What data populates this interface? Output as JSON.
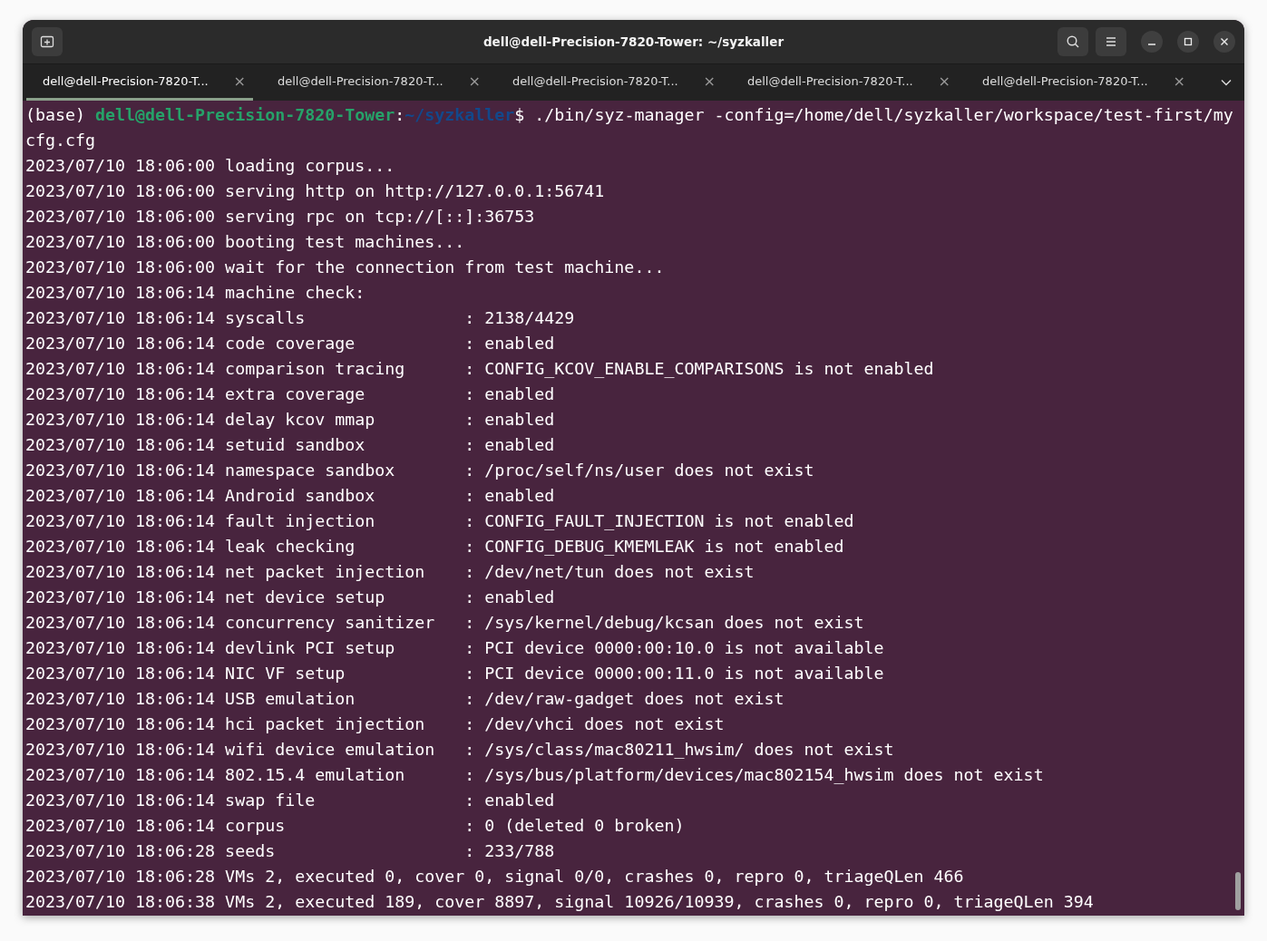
{
  "window": {
    "title": "dell@dell-Precision-7820-Tower: ~/syzkaller"
  },
  "tabs": [
    {
      "label": "dell@dell-Precision-7820-T...",
      "close": "×",
      "selected": true
    },
    {
      "label": "dell@dell-Precision-7820-T...",
      "close": "×",
      "selected": false
    },
    {
      "label": "dell@dell-Precision-7820-T...",
      "close": "×",
      "selected": false
    },
    {
      "label": "dell@dell-Precision-7820-T...",
      "close": "×",
      "selected": false
    },
    {
      "label": "dell@dell-Precision-7820-T...",
      "close": "×",
      "selected": false
    }
  ],
  "prompt": {
    "env": "(base) ",
    "user_host": "dell@dell-Precision-7820-Tower",
    "separator": ":",
    "path": "~/syzkaller",
    "symbol": "$ ",
    "command": "./bin/syz-manager -config=/home/dell/syzkaller/workspace/test-first/mycfg.cfg"
  },
  "lines": [
    "2023/07/10 18:06:00 loading corpus...",
    "2023/07/10 18:06:00 serving http on http://127.0.0.1:56741",
    "2023/07/10 18:06:00 serving rpc on tcp://[::]:36753",
    "2023/07/10 18:06:00 booting test machines...",
    "2023/07/10 18:06:00 wait for the connection from test machine...",
    "2023/07/10 18:06:14 machine check:",
    "2023/07/10 18:06:14 syscalls                : 2138/4429",
    "2023/07/10 18:06:14 code coverage           : enabled",
    "2023/07/10 18:06:14 comparison tracing      : CONFIG_KCOV_ENABLE_COMPARISONS is not enabled",
    "2023/07/10 18:06:14 extra coverage          : enabled",
    "2023/07/10 18:06:14 delay kcov mmap         : enabled",
    "2023/07/10 18:06:14 setuid sandbox          : enabled",
    "2023/07/10 18:06:14 namespace sandbox       : /proc/self/ns/user does not exist",
    "2023/07/10 18:06:14 Android sandbox         : enabled",
    "2023/07/10 18:06:14 fault injection         : CONFIG_FAULT_INJECTION is not enabled",
    "2023/07/10 18:06:14 leak checking           : CONFIG_DEBUG_KMEMLEAK is not enabled",
    "2023/07/10 18:06:14 net packet injection    : /dev/net/tun does not exist",
    "2023/07/10 18:06:14 net device setup        : enabled",
    "2023/07/10 18:06:14 concurrency sanitizer   : /sys/kernel/debug/kcsan does not exist",
    "2023/07/10 18:06:14 devlink PCI setup       : PCI device 0000:00:10.0 is not available",
    "2023/07/10 18:06:14 NIC VF setup            : PCI device 0000:00:11.0 is not available",
    "2023/07/10 18:06:14 USB emulation           : /dev/raw-gadget does not exist",
    "2023/07/10 18:06:14 hci packet injection    : /dev/vhci does not exist",
    "2023/07/10 18:06:14 wifi device emulation   : /sys/class/mac80211_hwsim/ does not exist",
    "2023/07/10 18:06:14 802.15.4 emulation      : /sys/bus/platform/devices/mac802154_hwsim does not exist",
    "2023/07/10 18:06:14 swap file               : enabled",
    "2023/07/10 18:06:14 corpus                  : 0 (deleted 0 broken)",
    "2023/07/10 18:06:28 seeds                   : 233/788",
    "2023/07/10 18:06:28 VMs 2, executed 0, cover 0, signal 0/0, crashes 0, repro 0, triageQLen 466",
    "2023/07/10 18:06:38 VMs 2, executed 189, cover 8897, signal 10926/10939, crashes 0, repro 0, triageQLen 394"
  ]
}
